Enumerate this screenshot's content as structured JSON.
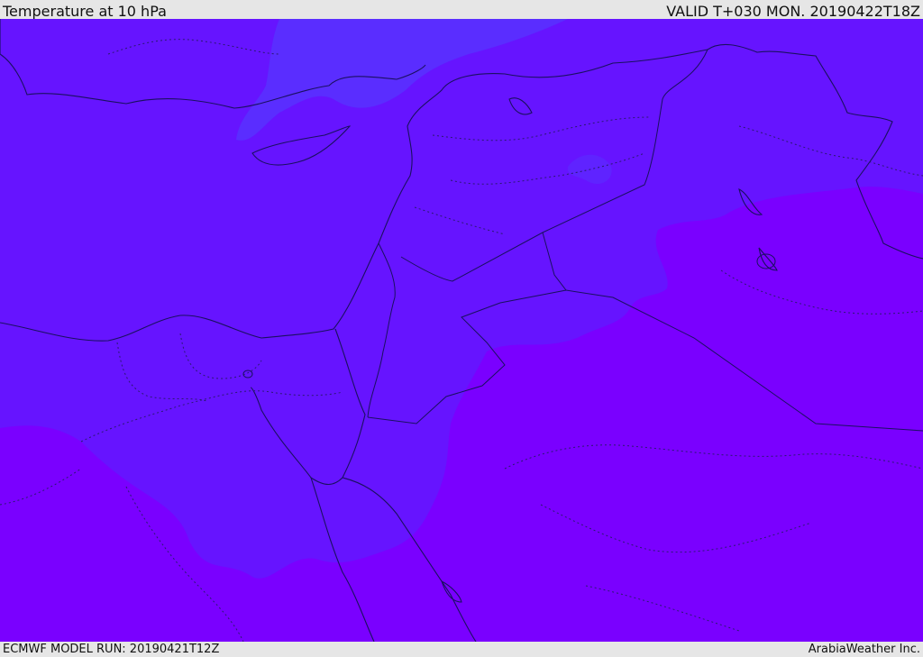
{
  "header": {
    "title": "Temperature at 10 hPa",
    "valid": "VALID T+030 MON. 20190422T18Z"
  },
  "footer": {
    "model_run": "ECMWF MODEL RUN: 20190421T12Z",
    "credit": "ArabiaWeather Inc."
  },
  "colors": {
    "warmest_band": "#7a00ff",
    "middle_band": "#6614ff",
    "coolest_band": "#5a2dff",
    "coastline": "#1a1060",
    "borders_dotted": "#2a1870",
    "labels_background": "#e6e6e6"
  }
}
